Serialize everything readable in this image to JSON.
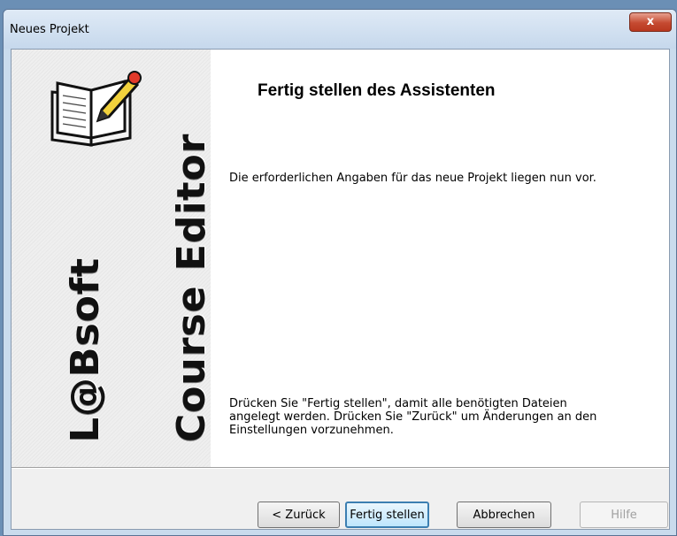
{
  "window": {
    "title": "Neues Projekt",
    "close_label": "x"
  },
  "side_panel": {
    "brand_text": "L@Bsoft",
    "product_text": "Course Editor",
    "icon": "book-pencil-icon"
  },
  "content": {
    "heading": "Fertig stellen des Assistenten",
    "paragraph1": "Die erforderlichen Angaben für das neue Projekt liegen nun vor.",
    "paragraph2": "Drücken Sie \"Fertig stellen\", damit alle benötigten Dateien angelegt werden. Drücken Sie \"Zurück\" um Änderungen an den Einstellungen vorzunehmen."
  },
  "buttons": {
    "back": "< Zurück",
    "finish": "Fertig stellen",
    "cancel": "Abbrechen",
    "help": "Hilfe"
  },
  "colors": {
    "close_button": "#c54a31",
    "default_button_border": "#3c7fb1"
  }
}
